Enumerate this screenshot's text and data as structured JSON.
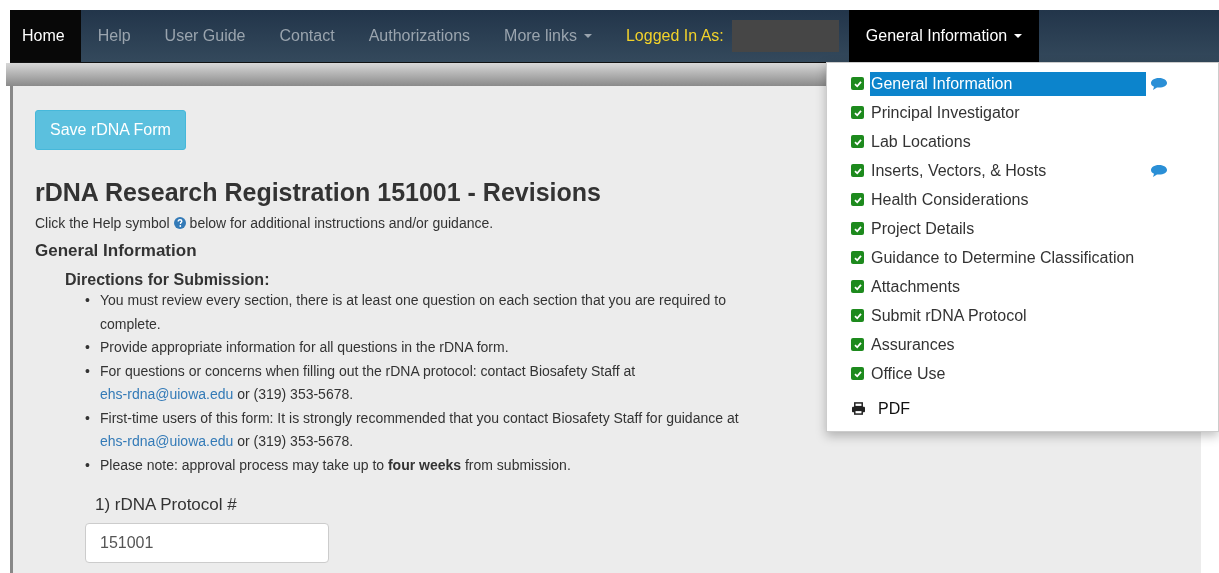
{
  "navbar": {
    "items": [
      {
        "label": "Home",
        "selected": true,
        "caret": false
      },
      {
        "label": "Help",
        "selected": false,
        "caret": false
      },
      {
        "label": "User Guide",
        "selected": false,
        "caret": false
      },
      {
        "label": "Contact",
        "selected": false,
        "caret": false
      },
      {
        "label": "Authorizations",
        "selected": false,
        "caret": false
      },
      {
        "label": "More links",
        "selected": false,
        "caret": true
      }
    ],
    "logged_in_label": "Logged In As:",
    "section_menu": {
      "label": "General Information",
      "expanded": true
    }
  },
  "save_button": "Save rDNA Form",
  "title": "rDNA Research Registration 151001 - Revisions",
  "help_note": {
    "before": "Click the Help symbol",
    "after": "below for additional instructions and/or guidance."
  },
  "section_heading": "General Information",
  "directions": {
    "heading": "Directions for Submission:",
    "bullets": [
      {
        "marker": "•",
        "parts": [
          {
            "kind": "text",
            "text": "You must review every section, there is at least one question on each section that you are required to complete."
          }
        ]
      },
      {
        "marker": "•",
        "parts": [
          {
            "kind": "text",
            "text": "Provide appropriate information for all questions in the rDNA form."
          }
        ]
      },
      {
        "marker": "•",
        "parts": [
          {
            "kind": "text",
            "text": "For questions or concerns when filling out the rDNA protocol: contact Biosafety Staff at "
          },
          {
            "kind": "link",
            "text": "ehs-rdna@uiowa.edu"
          },
          {
            "kind": "text",
            "text": " or (319) 353-5678."
          }
        ]
      },
      {
        "marker": "•",
        "parts": [
          {
            "kind": "text",
            "text": "First-time users of this form: It is strongly recommended that you contact Biosafety Staff for guidance at "
          },
          {
            "kind": "link",
            "text": "ehs-rdna@uiowa.edu"
          },
          {
            "kind": "text",
            "text": " or (319) 353-5678."
          }
        ]
      },
      {
        "marker": "•",
        "parts": [
          {
            "kind": "text",
            "text": "Please note: approval process may take up to **four weeks** from submission."
          }
        ]
      }
    ]
  },
  "question": {
    "label": "1) rDNA Protocol #",
    "value": "151001"
  },
  "dropdown": {
    "items": [
      {
        "label": "General Information",
        "checked": true,
        "selected": true,
        "comment": true
      },
      {
        "label": "Principal Investigator",
        "checked": true,
        "selected": false,
        "comment": false
      },
      {
        "label": "Lab Locations",
        "checked": true,
        "selected": false,
        "comment": false
      },
      {
        "label": "Inserts, Vectors, & Hosts",
        "checked": true,
        "selected": false,
        "comment": true
      },
      {
        "label": "Health Considerations",
        "checked": true,
        "selected": false,
        "comment": false
      },
      {
        "label": "Project Details",
        "checked": true,
        "selected": false,
        "comment": false
      },
      {
        "label": "Guidance to Determine Classification",
        "checked": true,
        "selected": false,
        "comment": false
      },
      {
        "label": "Attachments",
        "checked": true,
        "selected": false,
        "comment": false
      },
      {
        "label": "Submit rDNA Protocol",
        "checked": true,
        "selected": false,
        "comment": false
      },
      {
        "label": "Assurances",
        "checked": true,
        "selected": false,
        "comment": false
      },
      {
        "label": "Office Use",
        "checked": true,
        "selected": false,
        "comment": false
      }
    ],
    "pdf": "PDF"
  }
}
